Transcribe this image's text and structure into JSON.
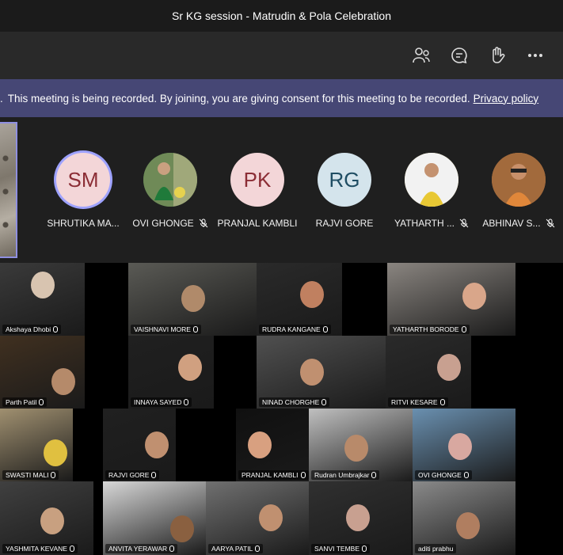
{
  "window": {
    "title": "Sr KG session - Matrudin & Pola Celebration"
  },
  "toolbar": {
    "icons": [
      "people-icon",
      "chat-icon",
      "raise-hand-icon",
      "more-options-icon"
    ]
  },
  "banner": {
    "lead": ".",
    "message": "This meeting is being recorded. By joining, you are giving consent for this meeting to be recorded.",
    "link_text": "Privacy policy"
  },
  "participants": [
    {
      "initials": "SM",
      "name": "SHRUTIKA MA...",
      "avatar_bg": "#f3d6d8",
      "initials_color": "#8b2d35",
      "muted": false,
      "speaking": true
    },
    {
      "initials": "",
      "name": "OVI GHONGE",
      "avatar_bg": "#2d6b3a",
      "muted": true,
      "speaking": false
    },
    {
      "initials": "PK",
      "name": "PRANJAL KAMBLI",
      "avatar_bg": "#f3d6d8",
      "initials_color": "#8b2d35",
      "muted": false,
      "speaking": false
    },
    {
      "initials": "RG",
      "name": "RAJVI GORE",
      "avatar_bg": "#d4e4ec",
      "initials_color": "#1f4d63",
      "muted": false,
      "speaking": false
    },
    {
      "initials": "",
      "name": "YATHARTH ...",
      "avatar_bg": "#e8d36a",
      "muted": true,
      "speaking": false
    },
    {
      "initials": "",
      "name": "ABHINAV S...",
      "avatar_bg": "#b8733f",
      "muted": true,
      "speaking": false
    }
  ],
  "tiles": [
    {
      "name": "Akshaya Dhobi"
    },
    {
      "name": "VAISHNAVI MORE"
    },
    {
      "name": "RUDRA KANGANE"
    },
    {
      "name": "YATHARTH BORODE"
    },
    {
      "name": "Parth Patil"
    },
    {
      "name": "INNAYA SAYED"
    },
    {
      "name": "NINAD CHORGHE"
    },
    {
      "name": "RITVI KESARE"
    },
    {
      "name": "SWASTI MALI"
    },
    {
      "name": "RAJVI GORE"
    },
    {
      "name": "PRANJAL KAMBLI"
    },
    {
      "name": "Rudran Umbrajkar"
    },
    {
      "name": "OVI GHONGE"
    },
    {
      "name": "YASHMITA KEVANE"
    },
    {
      "name": "ANVITA YERAWAR"
    },
    {
      "name": "AARYA PATIL"
    },
    {
      "name": "SANVI TEMBE"
    },
    {
      "name": "aditi prabhu"
    }
  ]
}
